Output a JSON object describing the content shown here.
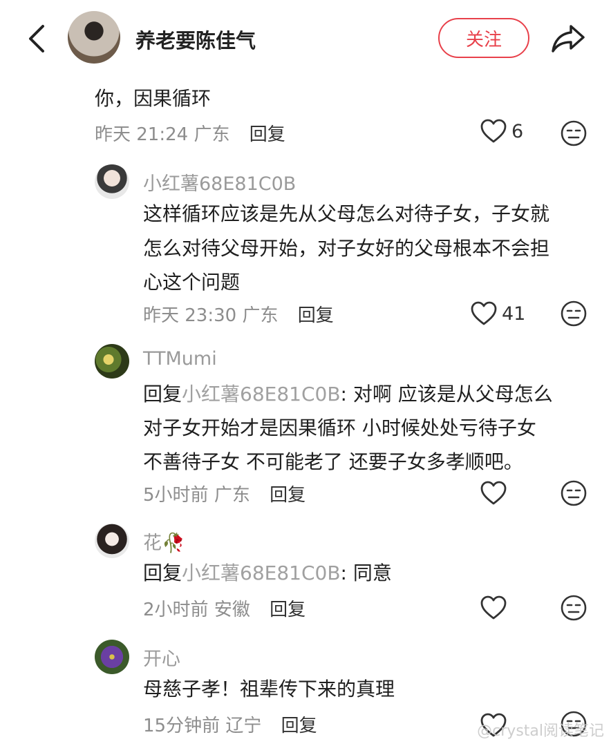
{
  "header": {
    "author_name": "养老要陈佳气",
    "follow_label": "关注"
  },
  "comments": [
    {
      "text": "你，因果循环",
      "time": "昨天 21:24",
      "location": "广东",
      "reply_label": "回复",
      "likes": "6"
    },
    {
      "username": "小红薯68E81C0B",
      "lines": [
        "这样循环应该是先从父母怎么对待子女，子女就",
        "怎么对待父母开始，对子女好的父母根本不会担",
        "心这个问题"
      ],
      "time": "昨天 23:30",
      "location": "广东",
      "reply_label": "回复",
      "likes": "41"
    },
    {
      "username": "TTMumi",
      "reply_prefix": "回复",
      "reply_target": "小红薯68E81C0B",
      "line1_rest": ": 对啊 应该是从父母怎么",
      "lines": [
        "对子女开始才是因果循环 小时候处处亏待子女",
        "不善待子女 不可能老了 还要子女多孝顺吧。"
      ],
      "time": "5小时前",
      "location": "广东",
      "reply_label": "回复"
    },
    {
      "username": "花🥀",
      "reply_prefix": "回复",
      "reply_target": "小红薯68E81C0B",
      "line1_rest": ": 同意",
      "time": "2小时前",
      "location": "安徽",
      "reply_label": "回复"
    },
    {
      "username": "开心",
      "text": "母慈子孝！祖辈传下来的真理",
      "time": "15分钟前",
      "location": "辽宁",
      "reply_label": "回复"
    }
  ],
  "watermark": "@crystal阅读笔记",
  "icons": [
    "back-arrow-icon",
    "share-icon",
    "heart-icon",
    "neutral-face-icon"
  ],
  "colors": {
    "accent": "#e8404a",
    "meta": "#8d8d8d"
  }
}
